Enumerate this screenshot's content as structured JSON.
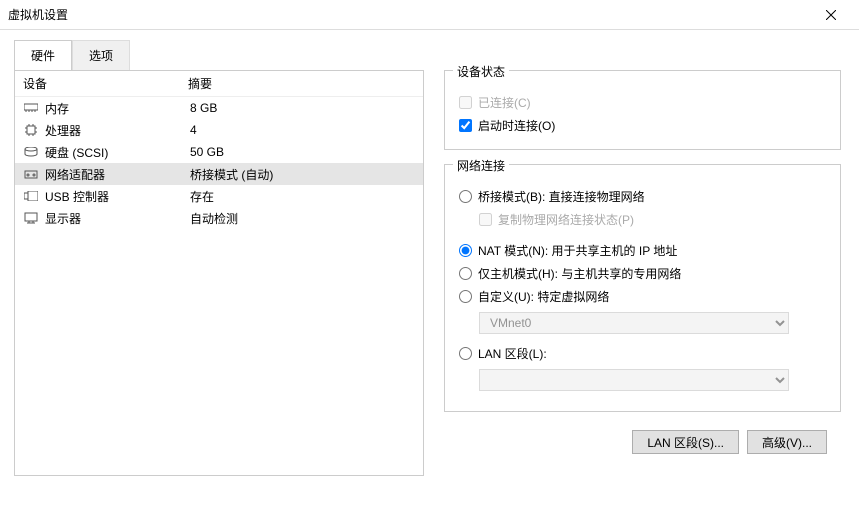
{
  "window": {
    "title": "虚拟机设置"
  },
  "tabs": {
    "hardware": "硬件",
    "options": "选项"
  },
  "columns": {
    "device": "设备",
    "summary": "摘要"
  },
  "devices": [
    {
      "name": "内存",
      "summary": "8 GB"
    },
    {
      "name": "处理器",
      "summary": "4"
    },
    {
      "name": "硬盘 (SCSI)",
      "summary": "50 GB"
    },
    {
      "name": "网络适配器",
      "summary": "桥接模式 (自动)"
    },
    {
      "name": "USB 控制器",
      "summary": "存在"
    },
    {
      "name": "显示器",
      "summary": "自动检测"
    }
  ],
  "status": {
    "title": "设备状态",
    "connected": "已连接(C)",
    "connectOnStart": "启动时连接(O)"
  },
  "net": {
    "title": "网络连接",
    "bridged": "桥接模式(B): 直接连接物理网络",
    "replicate": "复制物理网络连接状态(P)",
    "nat": "NAT 模式(N): 用于共享主机的 IP 地址",
    "hostonly": "仅主机模式(H): 与主机共享的专用网络",
    "custom": "自定义(U): 特定虚拟网络",
    "vmnet0": "VMnet0",
    "lan": "LAN 区段(L):"
  },
  "buttons": {
    "lanSeg": "LAN 区段(S)...",
    "advanced": "高级(V)..."
  }
}
